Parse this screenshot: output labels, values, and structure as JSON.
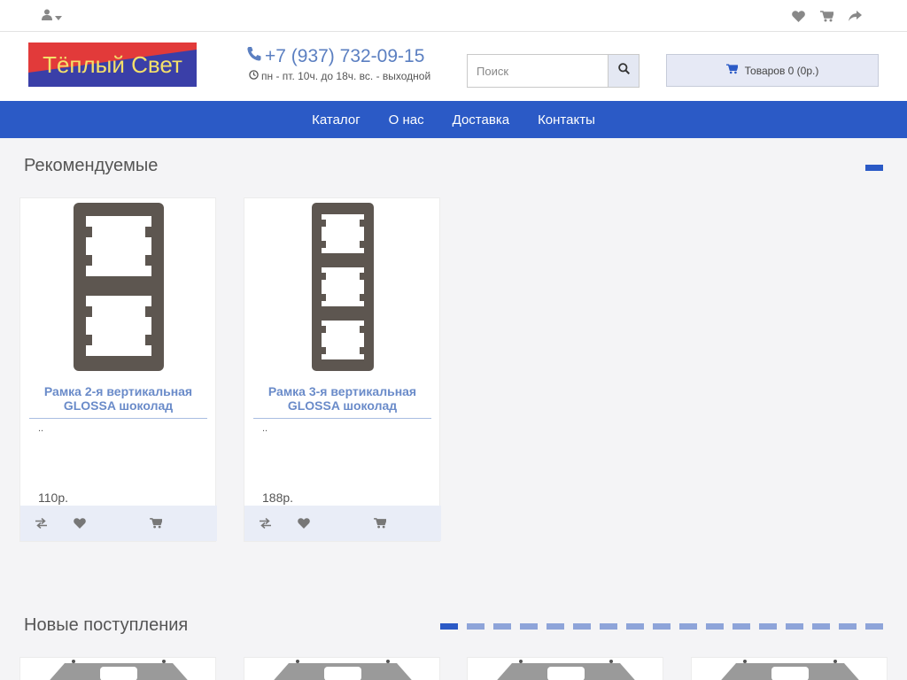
{
  "topbar": {
    "user_icon": "user-icon",
    "icons": [
      "heart-icon",
      "cart-icon",
      "share-icon"
    ]
  },
  "header": {
    "logo_text": "Тёплый Свет",
    "phone": "+7 (937) 732-09-15",
    "hours": "пн - пт. 10ч. до 18ч. вс. - выходной",
    "search_placeholder": "Поиск",
    "cart_label": "Товаров 0 (0р.)"
  },
  "nav": {
    "items": [
      "Каталог",
      "О нас",
      "Доставка",
      "Контакты"
    ]
  },
  "sections": {
    "recommended_title": "Рекомендуемые",
    "new_title": "Новые поступления"
  },
  "products": [
    {
      "name": "Рамка 2-я вертикальная GLOSSA шоколад",
      "desc": "..",
      "price": "110р."
    },
    {
      "name": "Рамка 3-я вертикальная GLOSSA шоколад",
      "desc": "..",
      "price": "188р."
    }
  ],
  "colors": {
    "accent": "#2b5ac6",
    "link": "#6a8bc9",
    "logo_bg_blue": "#3a3fa8",
    "logo_bg_red": "#e23a3a",
    "logo_text": "#f4e06a"
  }
}
